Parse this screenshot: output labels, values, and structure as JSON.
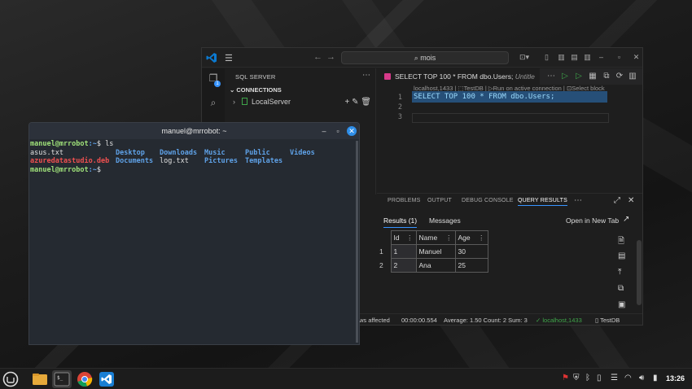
{
  "ads": {
    "search_text": "mois",
    "sidebar_title": "SQL SERVER",
    "connections_header": "CONNECTIONS",
    "server_name": "LocalServer",
    "tab_label": "SELECT TOP 100 * FROM dbo.Users;",
    "tab_untitled": "Untitle",
    "breadcrumb": "localhost,1433 | ⬚TestDB | ▷Run on active connection | ⊡Select block",
    "line_numbers": [
      "1",
      "2",
      "3"
    ],
    "code": "SELECT TOP 100 * FROM dbo.Users;",
    "panel_tabs": [
      "PROBLEMS",
      "OUTPUT",
      "DEBUG CONSOLE",
      "QUERY RESULTS"
    ],
    "result_tabs": [
      "Results (1)",
      "Messages"
    ],
    "open_new_tab": "Open in New Tab",
    "columns": [
      "Id",
      "Name",
      "Age"
    ],
    "rows": [
      {
        "row": "1",
        "id": "1",
        "name": "Manuel",
        "age": "30"
      },
      {
        "row": "2",
        "id": "2",
        "name": "Ana",
        "age": "25"
      }
    ],
    "status": {
      "affected": "ws affected",
      "elapsed": "00:00:00.554",
      "stats": "Average: 1.50  Count: 2  Sum: 3",
      "connection": "localhost,1433",
      "database": "TestDB"
    },
    "colors": {
      "accent": "#3794ff",
      "connected": "#3fa54a",
      "tab_icon": "#d73a8a"
    }
  },
  "terminal": {
    "title": "manuel@mrrobot: ~",
    "prompt_user": "manuel@mrrobot",
    "prompt_path": ":~",
    "prompt_symbol": "$ ",
    "command": "ls",
    "files": {
      "asus": "asus.txt",
      "deb": "azuredatastudio.deb",
      "log": "log.txt"
    },
    "dirs": [
      "Desktop",
      "Downloads",
      "Music",
      "Public",
      "Videos",
      "Documents",
      "Pictures",
      "Templates"
    ]
  },
  "taskbar": {
    "clock": "13:26",
    "apps": [
      "menu-icon",
      "files-icon",
      "terminal-icon",
      "chrome-icon",
      "vscode-icon"
    ]
  }
}
